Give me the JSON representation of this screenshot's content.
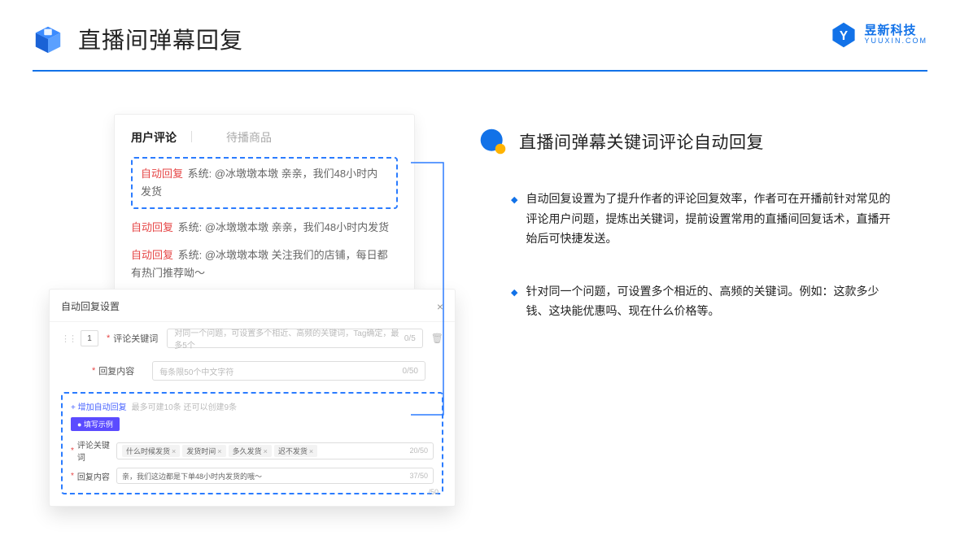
{
  "header": {
    "title": "直播间弹幕回复"
  },
  "logo": {
    "cn": "昱新科技",
    "en": "YUUXIN.COM"
  },
  "comments": {
    "tab_active": "用户评论",
    "tab_inactive": "待播商品",
    "rows": [
      {
        "tag": "自动回复",
        "text": "系统: @冰墩墩本墩 亲亲，我们48小时内发货"
      },
      {
        "tag": "自动回复",
        "text": "系统: @冰墩墩本墩 亲亲，我们48小时内发货"
      },
      {
        "tag": "自动回复",
        "text": "系统: @冰墩墩本墩 关注我们的店铺，每日都有热门推荐呦～"
      }
    ]
  },
  "settings": {
    "title": "自动回复设置",
    "order": "1",
    "keyword_label": "评论关键词",
    "keyword_placeholder": "对同一个问题，可设置多个相近、高频的关键词，Tag确定，最多5个",
    "keyword_counter": "0/5",
    "reply_label": "回复内容",
    "reply_placeholder": "每条限50个中文字符",
    "reply_counter": "0/50",
    "add_link": "+ 增加自动回复",
    "add_hint": "最多可建10条 还可以创建9条",
    "example_badge": "● 填写示例",
    "ex_keyword_label": "评论关键词",
    "ex_chips": [
      "什么时候发货",
      "发货时间",
      "多久发货",
      "迟不发货"
    ],
    "ex_keyword_counter": "20/50",
    "ex_reply_label": "回复内容",
    "ex_reply_text": "亲，我们这边都是下单48小时内发货的哦～",
    "ex_reply_counter": "37/50",
    "stray_counter": "/50"
  },
  "right": {
    "title": "直播间弹幕关键词评论自动回复",
    "bullets": [
      "自动回复设置为了提升作者的评论回复效率，作者可在开播前针对常见的评论用户问题，提炼出关键词，提前设置常用的直播间回复话术，直播开始后可快捷发送。",
      "针对同一个问题，可设置多个相近的、高频的关键词。例如：这款多少钱、这块能优惠吗、现在什么价格等。"
    ]
  }
}
